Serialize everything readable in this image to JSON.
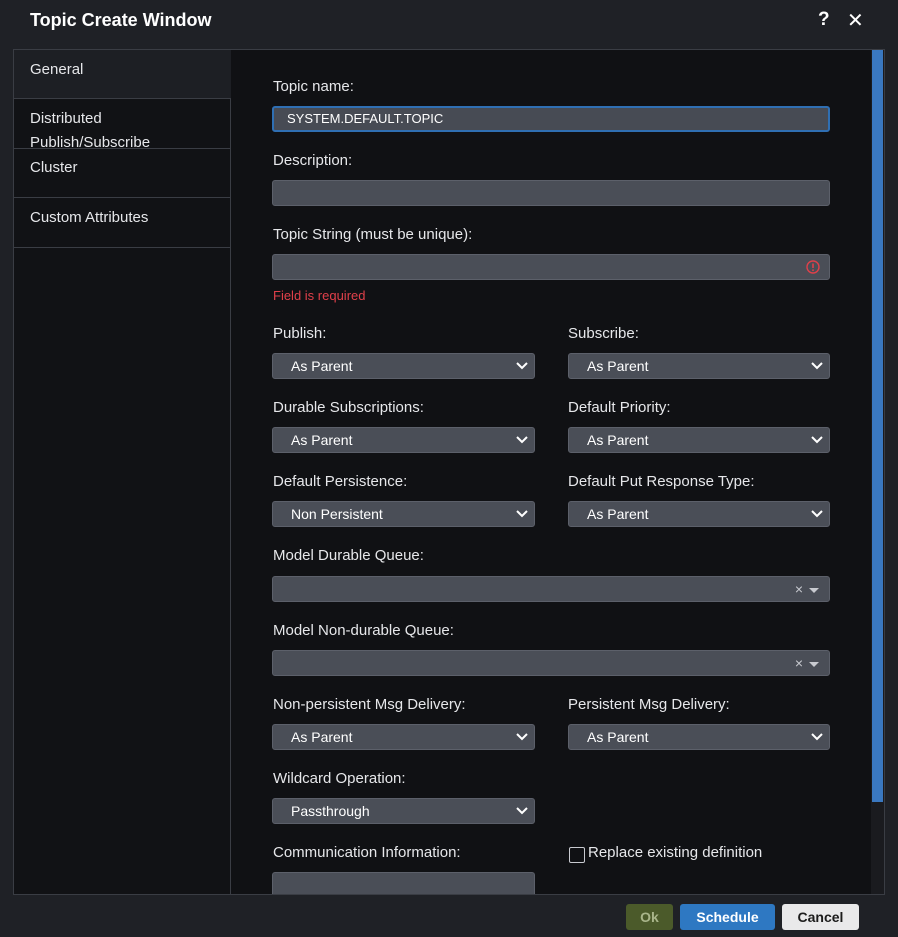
{
  "window": {
    "title": "Topic Create Window",
    "help_label": "?",
    "close_label": "✕"
  },
  "sidebar": {
    "items": [
      {
        "label": "General"
      },
      {
        "label": "Distributed Publish/Subscribe"
      },
      {
        "label": "Cluster"
      },
      {
        "label": "Custom Attributes"
      }
    ]
  },
  "form": {
    "topic_name": {
      "label": "Topic name:",
      "value": "SYSTEM.DEFAULT.TOPIC"
    },
    "description": {
      "label": "Description:",
      "value": ""
    },
    "topic_string": {
      "label": "Topic String (must be unique):",
      "value": "",
      "error": "Field is required"
    },
    "publish": {
      "label": "Publish:",
      "value": "As Parent"
    },
    "subscribe": {
      "label": "Subscribe:",
      "value": "As Parent"
    },
    "durable_subscriptions": {
      "label": "Durable Subscriptions:",
      "value": "As Parent"
    },
    "default_priority": {
      "label": "Default Priority:",
      "value": "As Parent"
    },
    "default_persistence": {
      "label": "Default Persistence:",
      "value": "Non Persistent"
    },
    "default_put_response_type": {
      "label": "Default Put Response Type:",
      "value": "As Parent"
    },
    "model_durable_queue": {
      "label": "Model Durable Queue:",
      "value": ""
    },
    "model_nondurable_queue": {
      "label": "Model Non-durable Queue:",
      "value": ""
    },
    "nonpersistent_msg_delivery": {
      "label": "Non-persistent Msg Delivery:",
      "value": "As Parent"
    },
    "persistent_msg_delivery": {
      "label": "Persistent Msg Delivery:",
      "value": "As Parent"
    },
    "wildcard_operation": {
      "label": "Wildcard Operation:",
      "value": "Passthrough"
    },
    "communication_information": {
      "label": "Communication Information:",
      "value": ""
    },
    "replace_existing": {
      "label": "Replace existing definition",
      "checked": false
    },
    "combo_clear": "×"
  },
  "footer": {
    "ok_label": "Ok",
    "schedule_label": "Schedule",
    "cancel_label": "Cancel"
  },
  "colors": {
    "accent": "#2e78c2",
    "error": "#e0404a",
    "ok_disabled": "#4b5a2a"
  }
}
